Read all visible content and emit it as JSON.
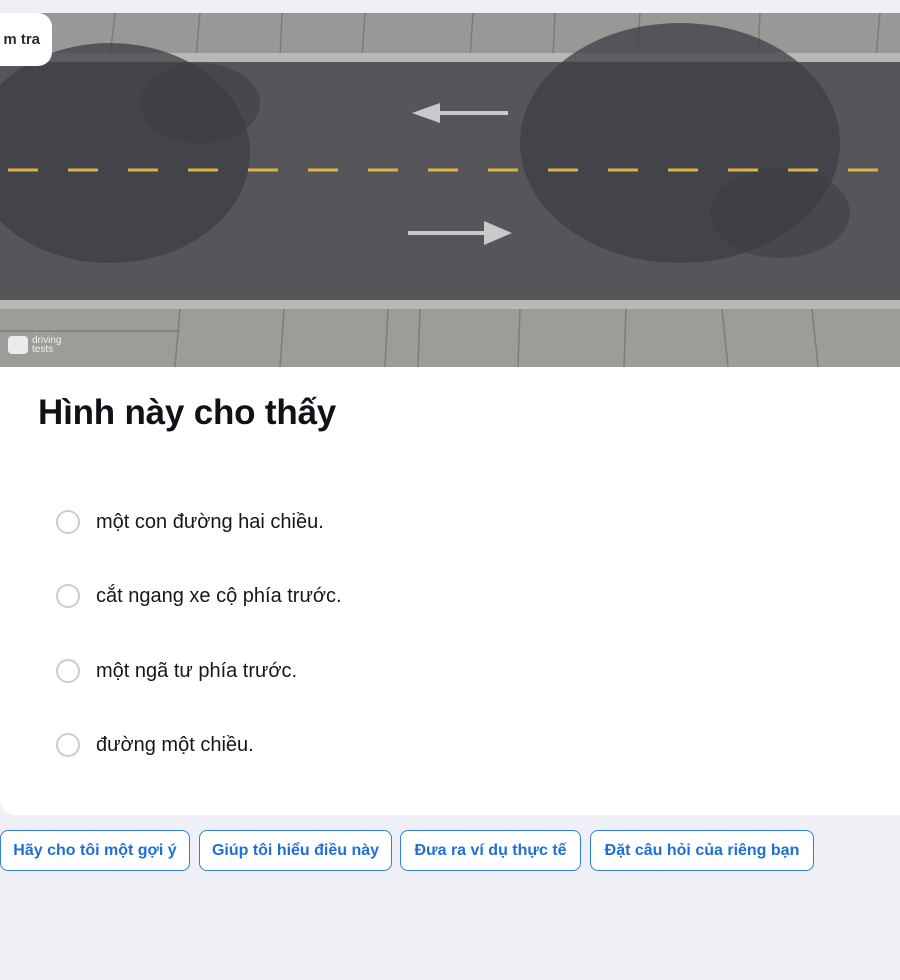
{
  "tag": {
    "label": "m tra"
  },
  "image": {
    "watermark_line1": "driving",
    "watermark_line2": "tests"
  },
  "question": {
    "title": "Hình này cho thấy"
  },
  "options": [
    {
      "label": "một con đường hai chiều."
    },
    {
      "label": "cắt ngang xe cộ phía trước."
    },
    {
      "label": "một ngã tư phía trước."
    },
    {
      "label": "đường một chiều."
    }
  ],
  "chips": [
    {
      "label": "Hãy cho tôi một gợi ý"
    },
    {
      "label": "Giúp tôi hiểu điều này"
    },
    {
      "label": "Đưa ra ví dụ thực tế"
    },
    {
      "label": "Đặt câu hỏi của riêng bạn"
    }
  ],
  "colors": {
    "page_bg": "#eef0f6",
    "chip_accent": "#1f6fd6",
    "radio_border": "#c9cbd6",
    "lane_line": "#e0b246"
  }
}
